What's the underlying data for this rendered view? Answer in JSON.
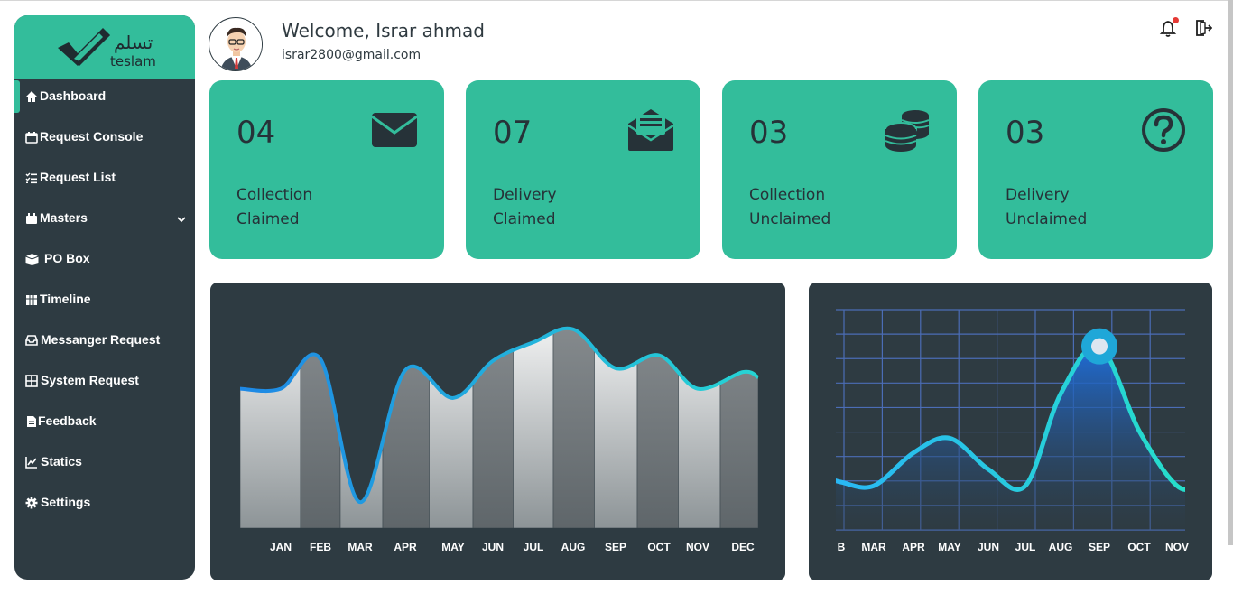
{
  "brand": {
    "arabic": "تسلم",
    "latin": "teslam"
  },
  "sidebar": {
    "items": [
      {
        "label": "Dashboard",
        "icon": "home-icon"
      },
      {
        "label": "Request Console",
        "icon": "calendar-icon"
      },
      {
        "label": "Request List",
        "icon": "checklist-icon"
      },
      {
        "label": "Masters",
        "icon": "masters-icon"
      },
      {
        "label": "PO Box",
        "icon": "box-icon"
      },
      {
        "label": "Timeline",
        "icon": "table-calendar-icon"
      },
      {
        "label": "Messanger Request",
        "icon": "inbox-icon"
      },
      {
        "label": "System Request",
        "icon": "grid-icon"
      },
      {
        "label": "Feedback",
        "icon": "document-icon"
      },
      {
        "label": "Statics",
        "icon": "line-chart-icon"
      },
      {
        "label": "Settings",
        "icon": "gear-icon"
      }
    ]
  },
  "header": {
    "welcome": "Welcome, Israr ahmad",
    "email": "israr2800@gmail.com"
  },
  "cards": [
    {
      "value": "04",
      "line1": "Collection",
      "line2": "Claimed",
      "icon": "envelope-icon"
    },
    {
      "value": "07",
      "line1": "Delivery",
      "line2": "Claimed",
      "icon": "open-envelope-icon"
    },
    {
      "value": "03",
      "line1": "Collection",
      "line2": "Unclaimed",
      "icon": "coins-icon"
    },
    {
      "value": "03",
      "line1": "Delivery",
      "line2": "Unclaimed",
      "icon": "question-circle-icon"
    }
  ],
  "colors": {
    "accent": "#33bd9b",
    "sidebar": "#2e3b42",
    "text": "#2f3a40"
  },
  "chart_data": [
    {
      "type": "area",
      "title": "",
      "categories": [
        "JAN",
        "FEB",
        "MAR",
        "APR",
        "MAY",
        "JUN",
        "JUL",
        "AUG",
        "SEP",
        "OCT",
        "NOV",
        "DEC"
      ],
      "values": [
        75,
        91,
        14,
        85,
        70,
        90,
        100,
        107,
        86,
        93,
        75,
        84
      ],
      "ylim": [
        0,
        120
      ],
      "grid": false
    },
    {
      "type": "area",
      "title": "",
      "categories": [
        "B",
        "MAR",
        "APR",
        "MAY",
        "JUN",
        "JUL",
        "AUG",
        "SEP",
        "OCT",
        "NOV"
      ],
      "values": [
        26,
        24,
        42,
        50,
        33,
        24,
        74,
        100,
        54,
        24
      ],
      "ylim": [
        0,
        120
      ],
      "grid": true
    }
  ]
}
